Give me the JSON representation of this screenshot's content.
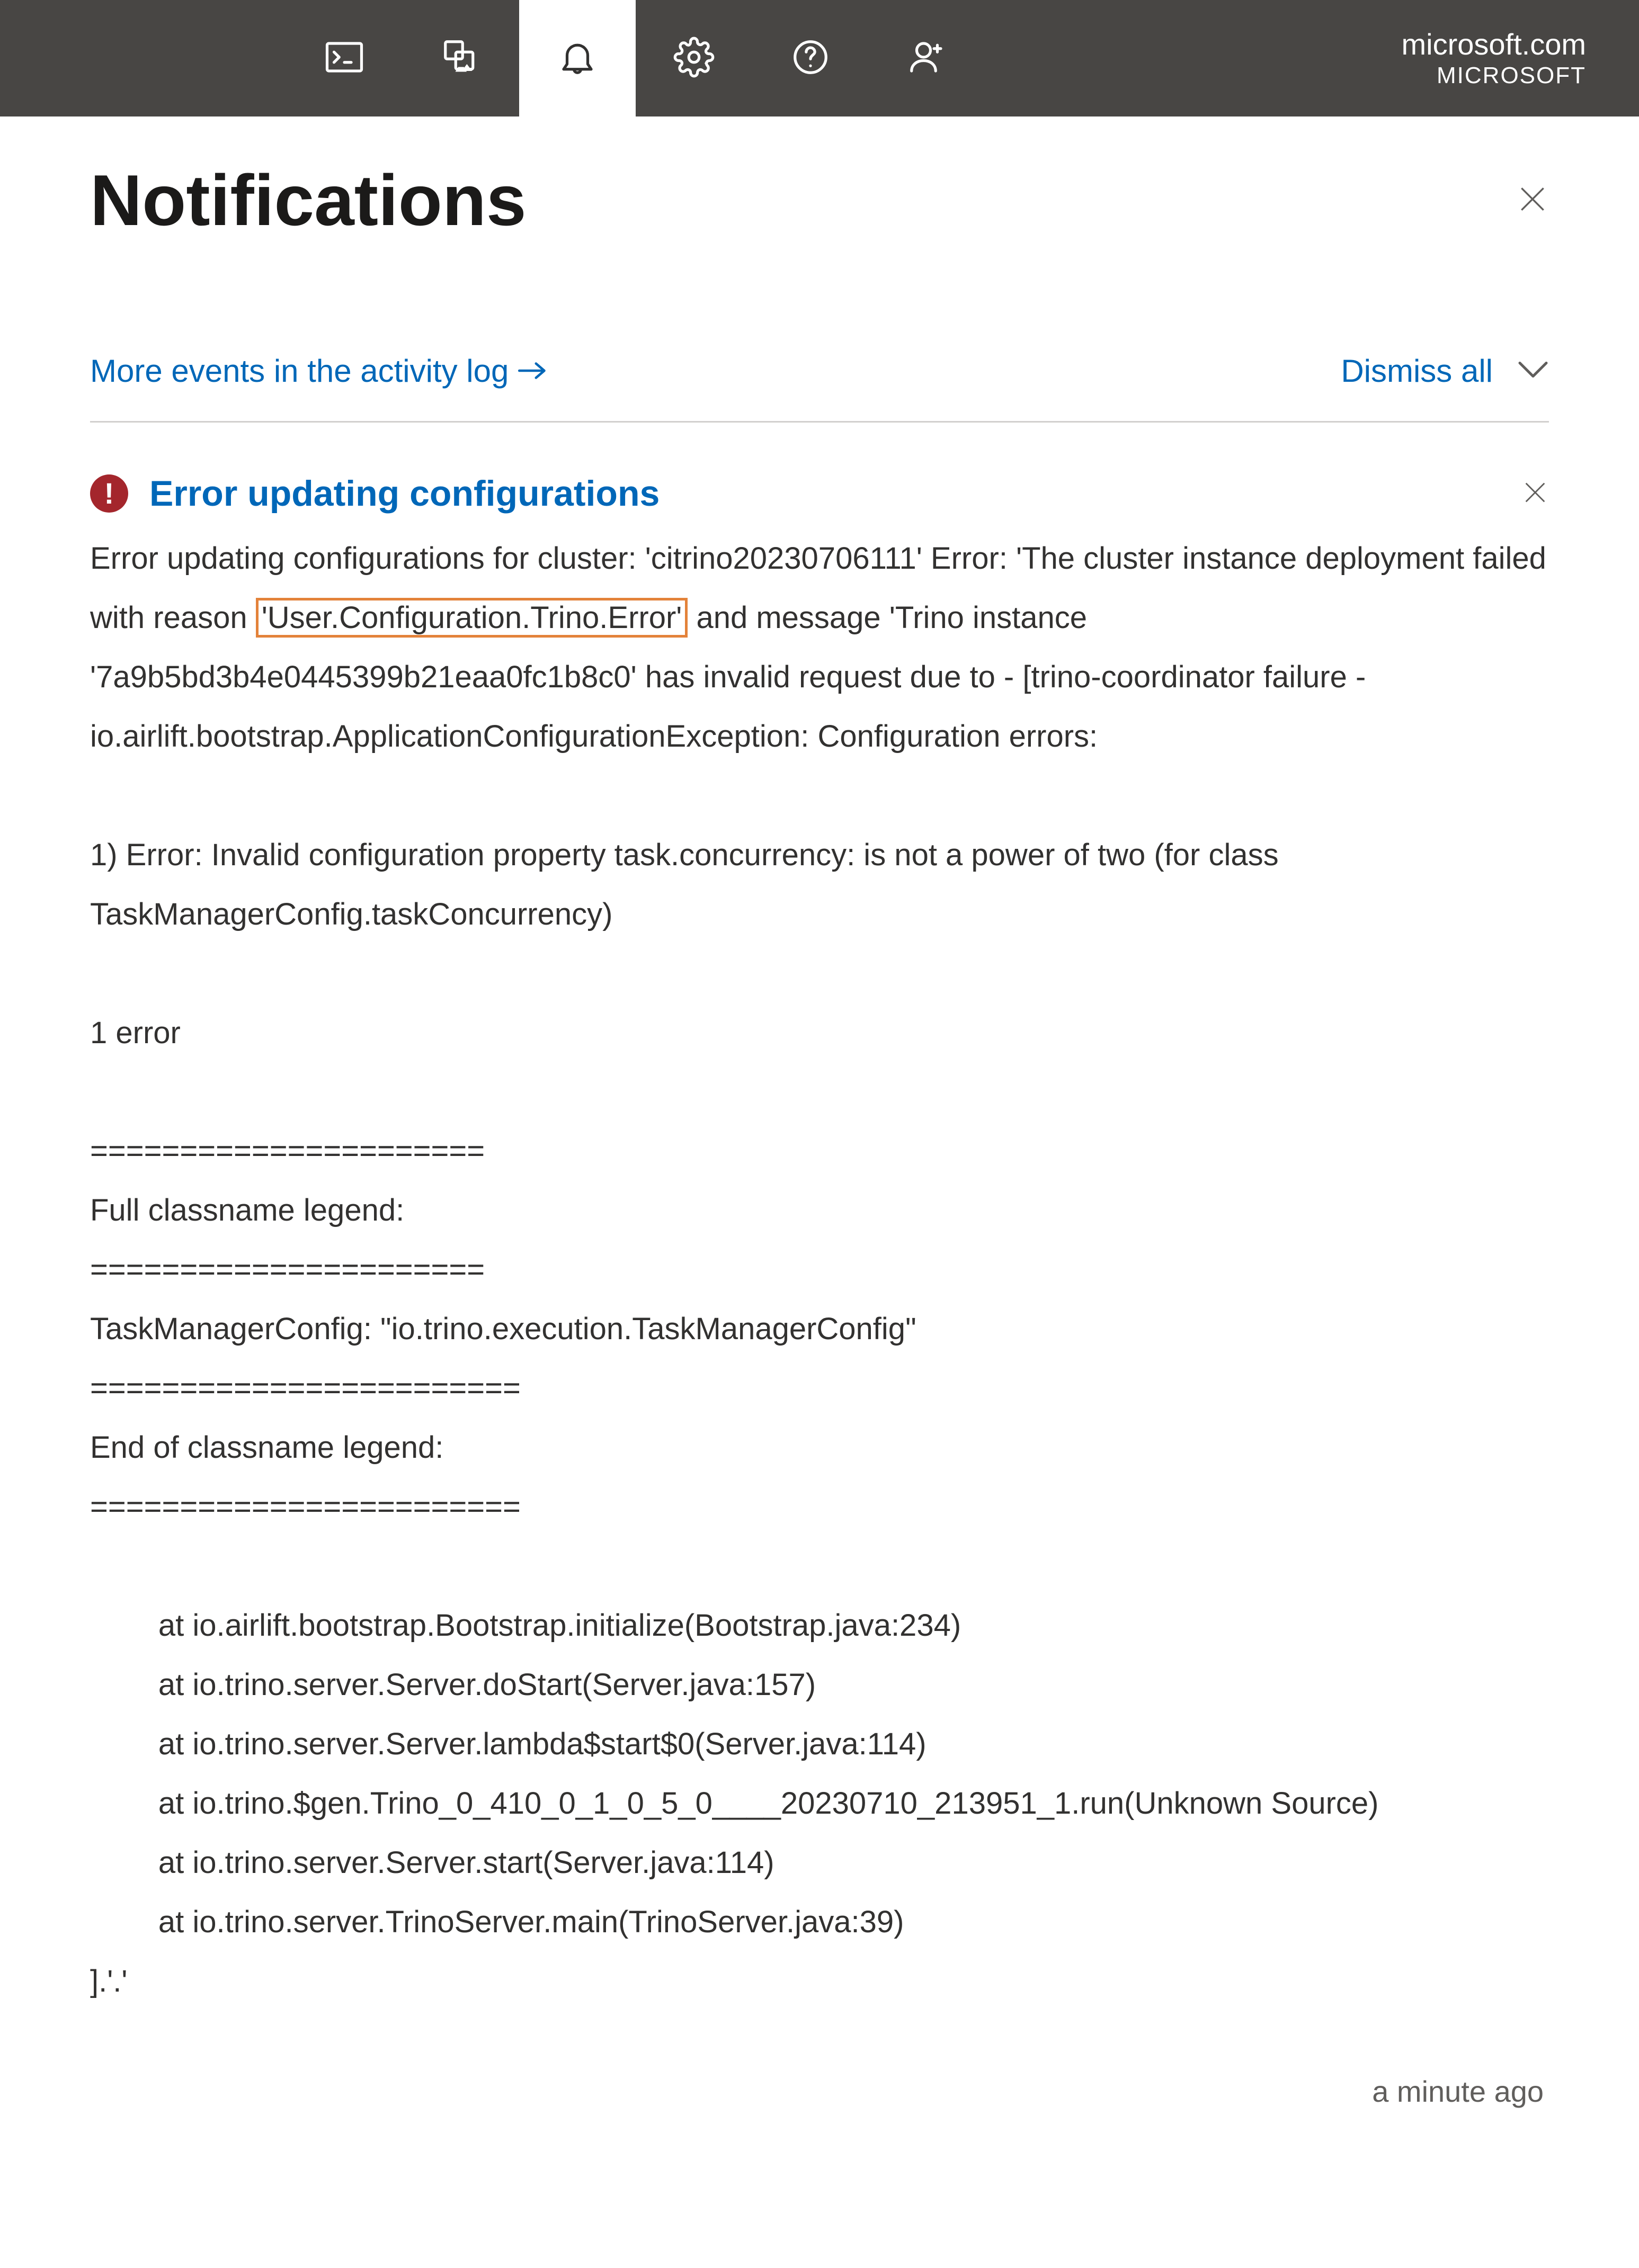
{
  "header": {
    "account_domain": "microsoft.com",
    "account_org": "MICROSOFT"
  },
  "panel": {
    "title": "Notifications",
    "activity_link": "More events in the activity log",
    "dismiss_all": "Dismiss all"
  },
  "notification": {
    "title": "Error updating configurations",
    "error_icon_glyph": "!",
    "body_pre": "Error updating configurations for cluster: 'citrino20230706111' Error: 'The cluster instance deployment failed with reason ",
    "body_highlight": "'User.Configuration.Trino.Error'",
    "body_post": " and message 'Trino instance '7a9b5bd3b4e0445399b21eaa0fc1b8c0' has invalid request due to - [trino-coordinator failure - io.airlift.bootstrap.ApplicationConfigurationException: Configuration errors:\n\n1) Error: Invalid configuration property task.concurrency: is not a power of two (for class TaskManagerConfig.taskConcurrency)\n\n1 error\n\n======================\nFull classname legend:\n======================\nTaskManagerConfig: \"io.trino.execution.TaskManagerConfig\"\n========================\nEnd of classname legend:\n========================\n\n        at io.airlift.bootstrap.Bootstrap.initialize(Bootstrap.java:234)\n        at io.trino.server.Server.doStart(Server.java:157)\n        at io.trino.server.Server.lambda$start$0(Server.java:114)\n        at io.trino.$gen.Trino_0_410_0_1_0_5_0____20230710_213951_1.run(Unknown Source)\n        at io.trino.server.Server.start(Server.java:114)\n        at io.trino.server.TrinoServer.main(TrinoServer.java:39)\n].'.'",
    "timestamp": "a minute ago"
  }
}
